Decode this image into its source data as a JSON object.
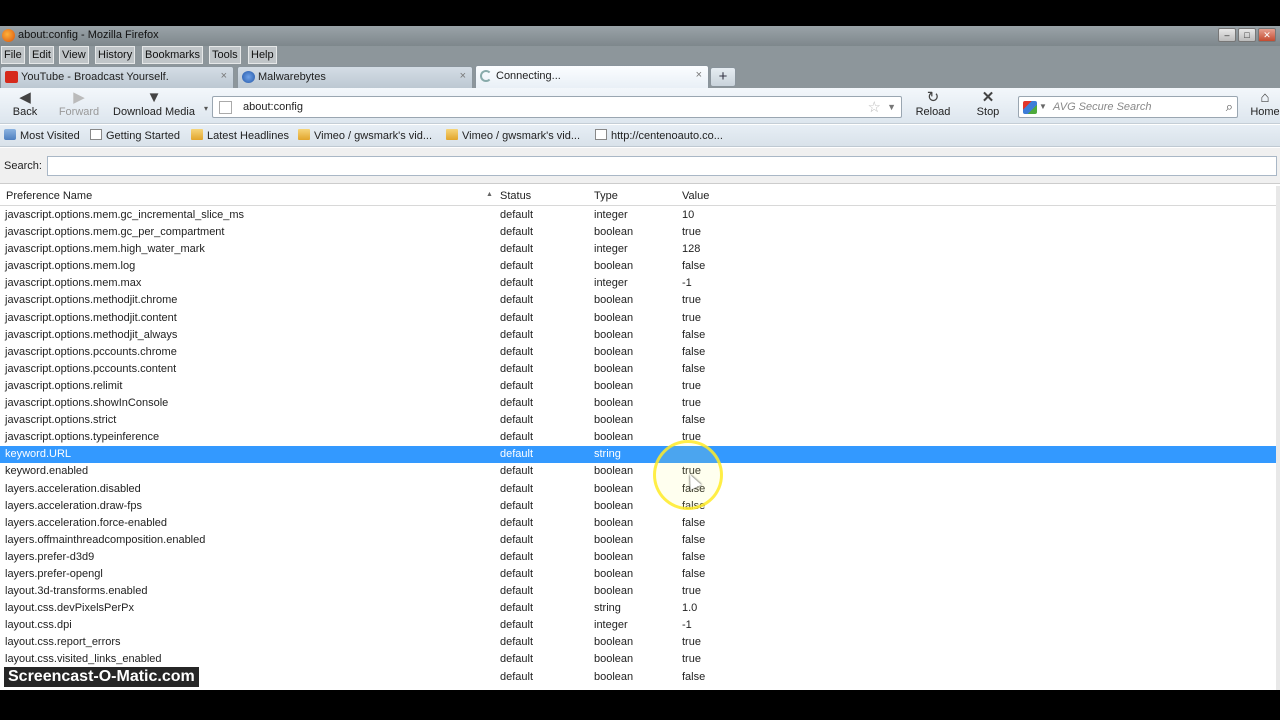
{
  "window": {
    "title": "about:config - Mozilla Firefox"
  },
  "menu": [
    "File",
    "Edit",
    "View",
    "History",
    "Bookmarks",
    "Tools",
    "Help"
  ],
  "tabs": [
    {
      "label": "YouTube - Broadcast Yourself.",
      "icon": "youtube-icon",
      "close": "×"
    },
    {
      "label": "Malwarebytes",
      "icon": "globe-icon",
      "close": "×"
    },
    {
      "label": "Connecting...",
      "icon": "loading-icon",
      "close": "×"
    }
  ],
  "nav": {
    "back": "Back",
    "forward": "Forward",
    "download": "Download Media",
    "url": "about:config",
    "reload": "Reload",
    "stop": "Stop",
    "home": "Home",
    "search_placeholder": "AVG Secure Search"
  },
  "bookmarks": [
    "Most Visited",
    "Getting Started",
    "Latest Headlines",
    "Vimeo / gwsmark's vid...",
    "Vimeo / gwsmark's vid...",
    "http://centenoauto.co..."
  ],
  "config": {
    "search_label": "Search:",
    "columns": {
      "name": "Preference Name",
      "status": "Status",
      "type": "Type",
      "value": "Value"
    },
    "rows": [
      {
        "name": "javascript.options.mem.gc_incremental_slice_ms",
        "status": "default",
        "type": "integer",
        "value": "10"
      },
      {
        "name": "javascript.options.mem.gc_per_compartment",
        "status": "default",
        "type": "boolean",
        "value": "true"
      },
      {
        "name": "javascript.options.mem.high_water_mark",
        "status": "default",
        "type": "integer",
        "value": "128"
      },
      {
        "name": "javascript.options.mem.log",
        "status": "default",
        "type": "boolean",
        "value": "false"
      },
      {
        "name": "javascript.options.mem.max",
        "status": "default",
        "type": "integer",
        "value": "-1"
      },
      {
        "name": "javascript.options.methodjit.chrome",
        "status": "default",
        "type": "boolean",
        "value": "true"
      },
      {
        "name": "javascript.options.methodjit.content",
        "status": "default",
        "type": "boolean",
        "value": "true"
      },
      {
        "name": "javascript.options.methodjit_always",
        "status": "default",
        "type": "boolean",
        "value": "false"
      },
      {
        "name": "javascript.options.pccounts.chrome",
        "status": "default",
        "type": "boolean",
        "value": "false"
      },
      {
        "name": "javascript.options.pccounts.content",
        "status": "default",
        "type": "boolean",
        "value": "false"
      },
      {
        "name": "javascript.options.relimit",
        "status": "default",
        "type": "boolean",
        "value": "true"
      },
      {
        "name": "javascript.options.showInConsole",
        "status": "default",
        "type": "boolean",
        "value": "true"
      },
      {
        "name": "javascript.options.strict",
        "status": "default",
        "type": "boolean",
        "value": "false"
      },
      {
        "name": "javascript.options.typeinference",
        "status": "default",
        "type": "boolean",
        "value": "true"
      },
      {
        "name": "keyword.URL",
        "status": "default",
        "type": "string",
        "value": ""
      },
      {
        "name": "keyword.enabled",
        "status": "default",
        "type": "boolean",
        "value": "true"
      },
      {
        "name": "layers.acceleration.disabled",
        "status": "default",
        "type": "boolean",
        "value": "false"
      },
      {
        "name": "layers.acceleration.draw-fps",
        "status": "default",
        "type": "boolean",
        "value": "false"
      },
      {
        "name": "layers.acceleration.force-enabled",
        "status": "default",
        "type": "boolean",
        "value": "false"
      },
      {
        "name": "layers.offmainthreadcomposition.enabled",
        "status": "default",
        "type": "boolean",
        "value": "false"
      },
      {
        "name": "layers.prefer-d3d9",
        "status": "default",
        "type": "boolean",
        "value": "false"
      },
      {
        "name": "layers.prefer-opengl",
        "status": "default",
        "type": "boolean",
        "value": "false"
      },
      {
        "name": "layout.3d-transforms.enabled",
        "status": "default",
        "type": "boolean",
        "value": "true"
      },
      {
        "name": "layout.css.devPixelsPerPx",
        "status": "default",
        "type": "string",
        "value": "1.0"
      },
      {
        "name": "layout.css.dpi",
        "status": "default",
        "type": "integer",
        "value": "-1"
      },
      {
        "name": "layout.css.report_errors",
        "status": "default",
        "type": "boolean",
        "value": "true"
      },
      {
        "name": "layout.css.visited_links_enabled",
        "status": "default",
        "type": "boolean",
        "value": "true"
      },
      {
        "name": "",
        "status": "default",
        "type": "boolean",
        "value": "false"
      }
    ],
    "selected_index": 14
  },
  "watermark": "Screencast-O-Matic.com",
  "colors": {
    "selection": "#3399ff",
    "cursor_highlight": "#ffeb28"
  }
}
